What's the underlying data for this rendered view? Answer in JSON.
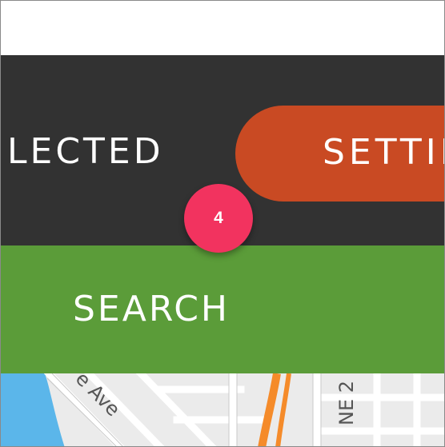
{
  "header": {
    "selected_label": "LECTED",
    "settings_label": "SETTIN"
  },
  "search": {
    "label": "SEARCH"
  },
  "badge": {
    "number": "4"
  },
  "map": {
    "street_ave": "e Ave",
    "street_ne": "NE 2"
  },
  "colors": {
    "dark_bar": "#323232",
    "settings_button": "#c94a23",
    "search_bar": "#5b9c39",
    "badge": "#f2335f",
    "water": "#5bb6ea",
    "highway": "#f58b2a"
  },
  "icons": {
    "badge": "step-number-badge"
  }
}
